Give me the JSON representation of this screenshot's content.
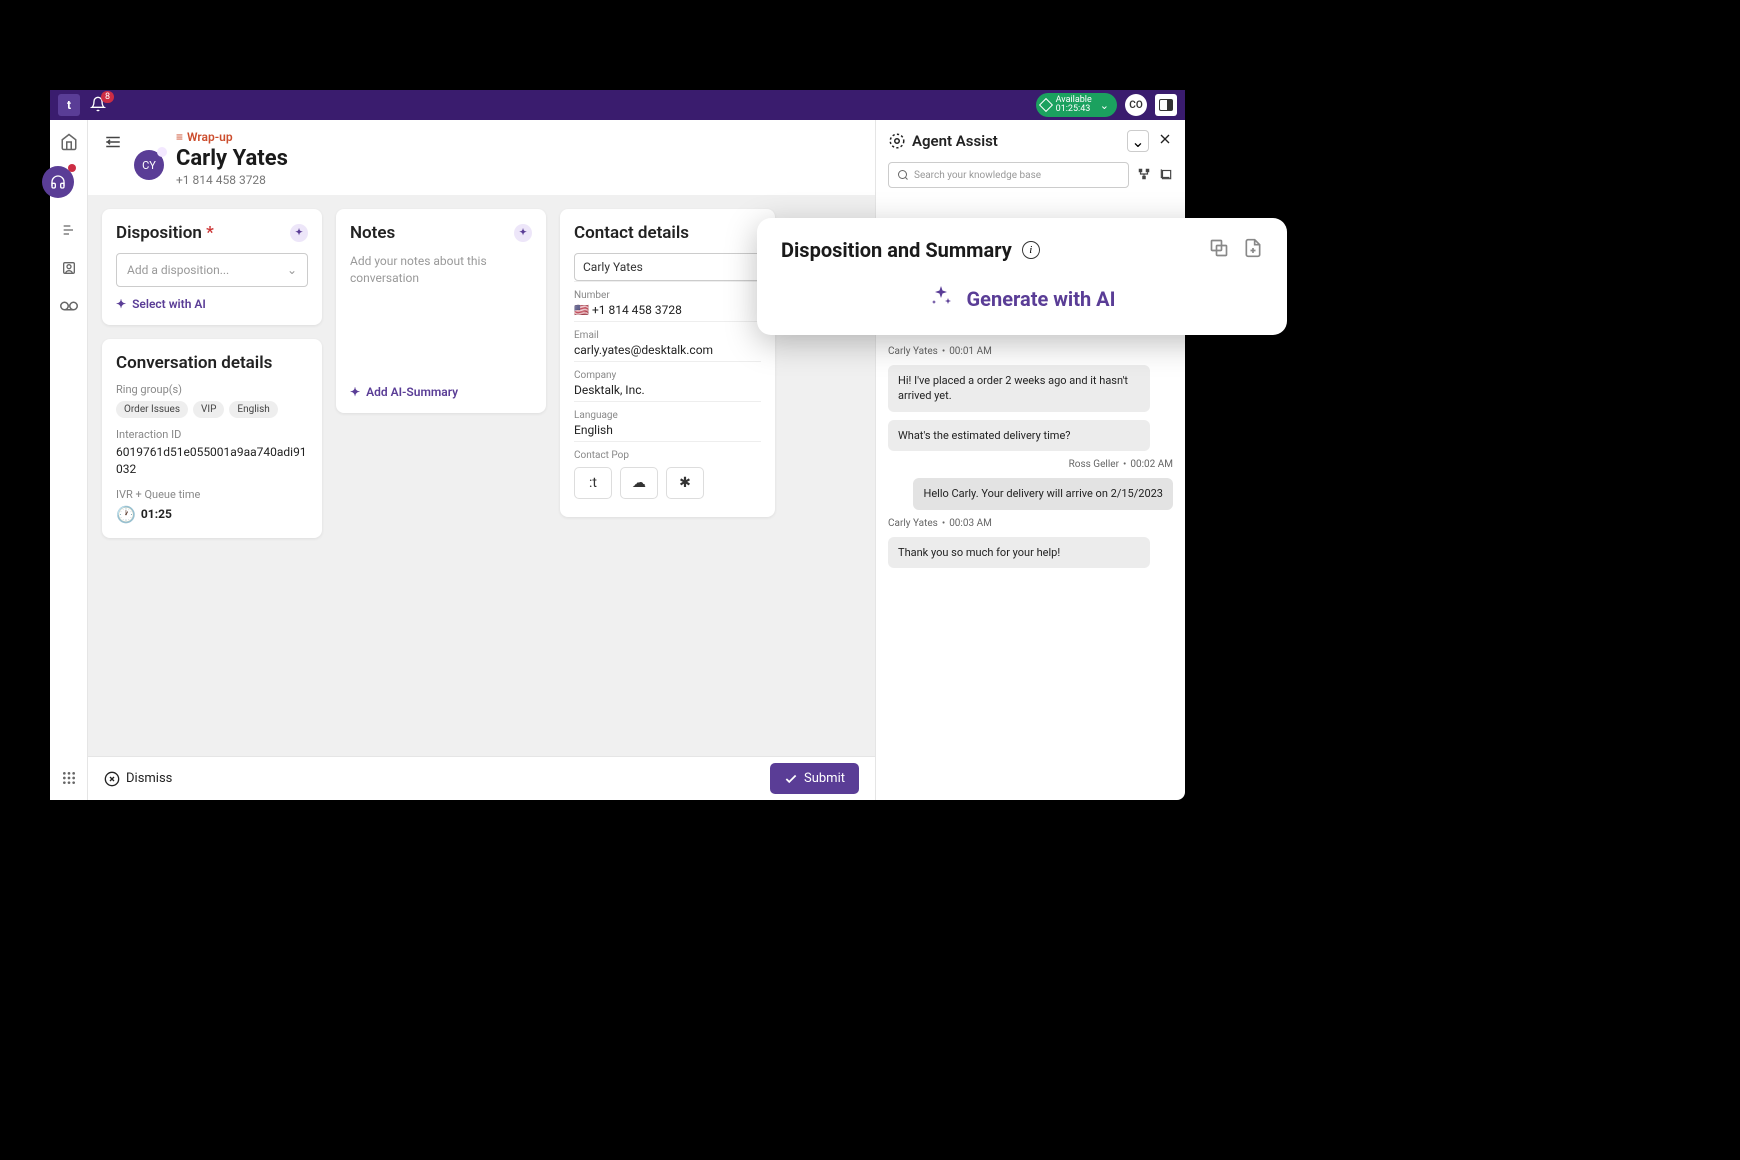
{
  "topbar": {
    "notif_count": "8",
    "status_label": "Available",
    "status_time": "01:25:43",
    "avatar": "CO"
  },
  "header": {
    "wrapup": "Wrap-up",
    "contact_name": "Carly Yates",
    "contact_phone": "+1 814 458 3728",
    "avatar_initials": "CY"
  },
  "disposition": {
    "title": "Disposition",
    "placeholder": "Add a disposition...",
    "select_ai": "Select with AI"
  },
  "notes": {
    "title": "Notes",
    "placeholder": "Add your notes about this conversation",
    "add_summary": "Add AI-Summary"
  },
  "conversation": {
    "title": "Conversation details",
    "ring_groups_label": "Ring group(s)",
    "chips": [
      "Order Issues",
      "VIP",
      "English"
    ],
    "interaction_label": "Interaction ID",
    "interaction_id": "6019761d51e055001a9aa740adi91032",
    "ivr_label": "IVR + Queue time",
    "ivr_time": "01:25"
  },
  "contact_details": {
    "title": "Contact details",
    "name_value": "Carly Yates",
    "fields": {
      "number_label": "Number",
      "number_value": "+1 814 458 3728",
      "email_label": "Email",
      "email_value": "carly.yates@desktalk.com",
      "company_label": "Company",
      "company_value": "Desktalk, Inc.",
      "language_label": "Language",
      "language_value": "English",
      "contact_pop_label": "Contact Pop"
    }
  },
  "footer": {
    "dismiss": "Dismiss",
    "submit": "Submit"
  },
  "assist": {
    "title": "Agent Assist",
    "search_placeholder": "Search your knowledge base",
    "messages": [
      {
        "author": "Carly Yates",
        "time": "00:01  AM",
        "side": "left",
        "text": "Hi! I've placed a order 2 weeks ago and it hasn't arrived yet."
      },
      {
        "author": "",
        "time": "",
        "side": "left",
        "text": "What's the estimated delivery time?"
      },
      {
        "author": "Ross Geller",
        "time": "00:02  AM",
        "side": "right",
        "text": "Hello Carly. Your delivery will arrive on 2/15/2023"
      },
      {
        "author": "Carly Yates",
        "time": "00:03  AM",
        "side": "left",
        "text": "Thank you so much for your help!"
      }
    ]
  },
  "popup": {
    "title": "Disposition and Summary",
    "generate": "Generate with AI"
  }
}
